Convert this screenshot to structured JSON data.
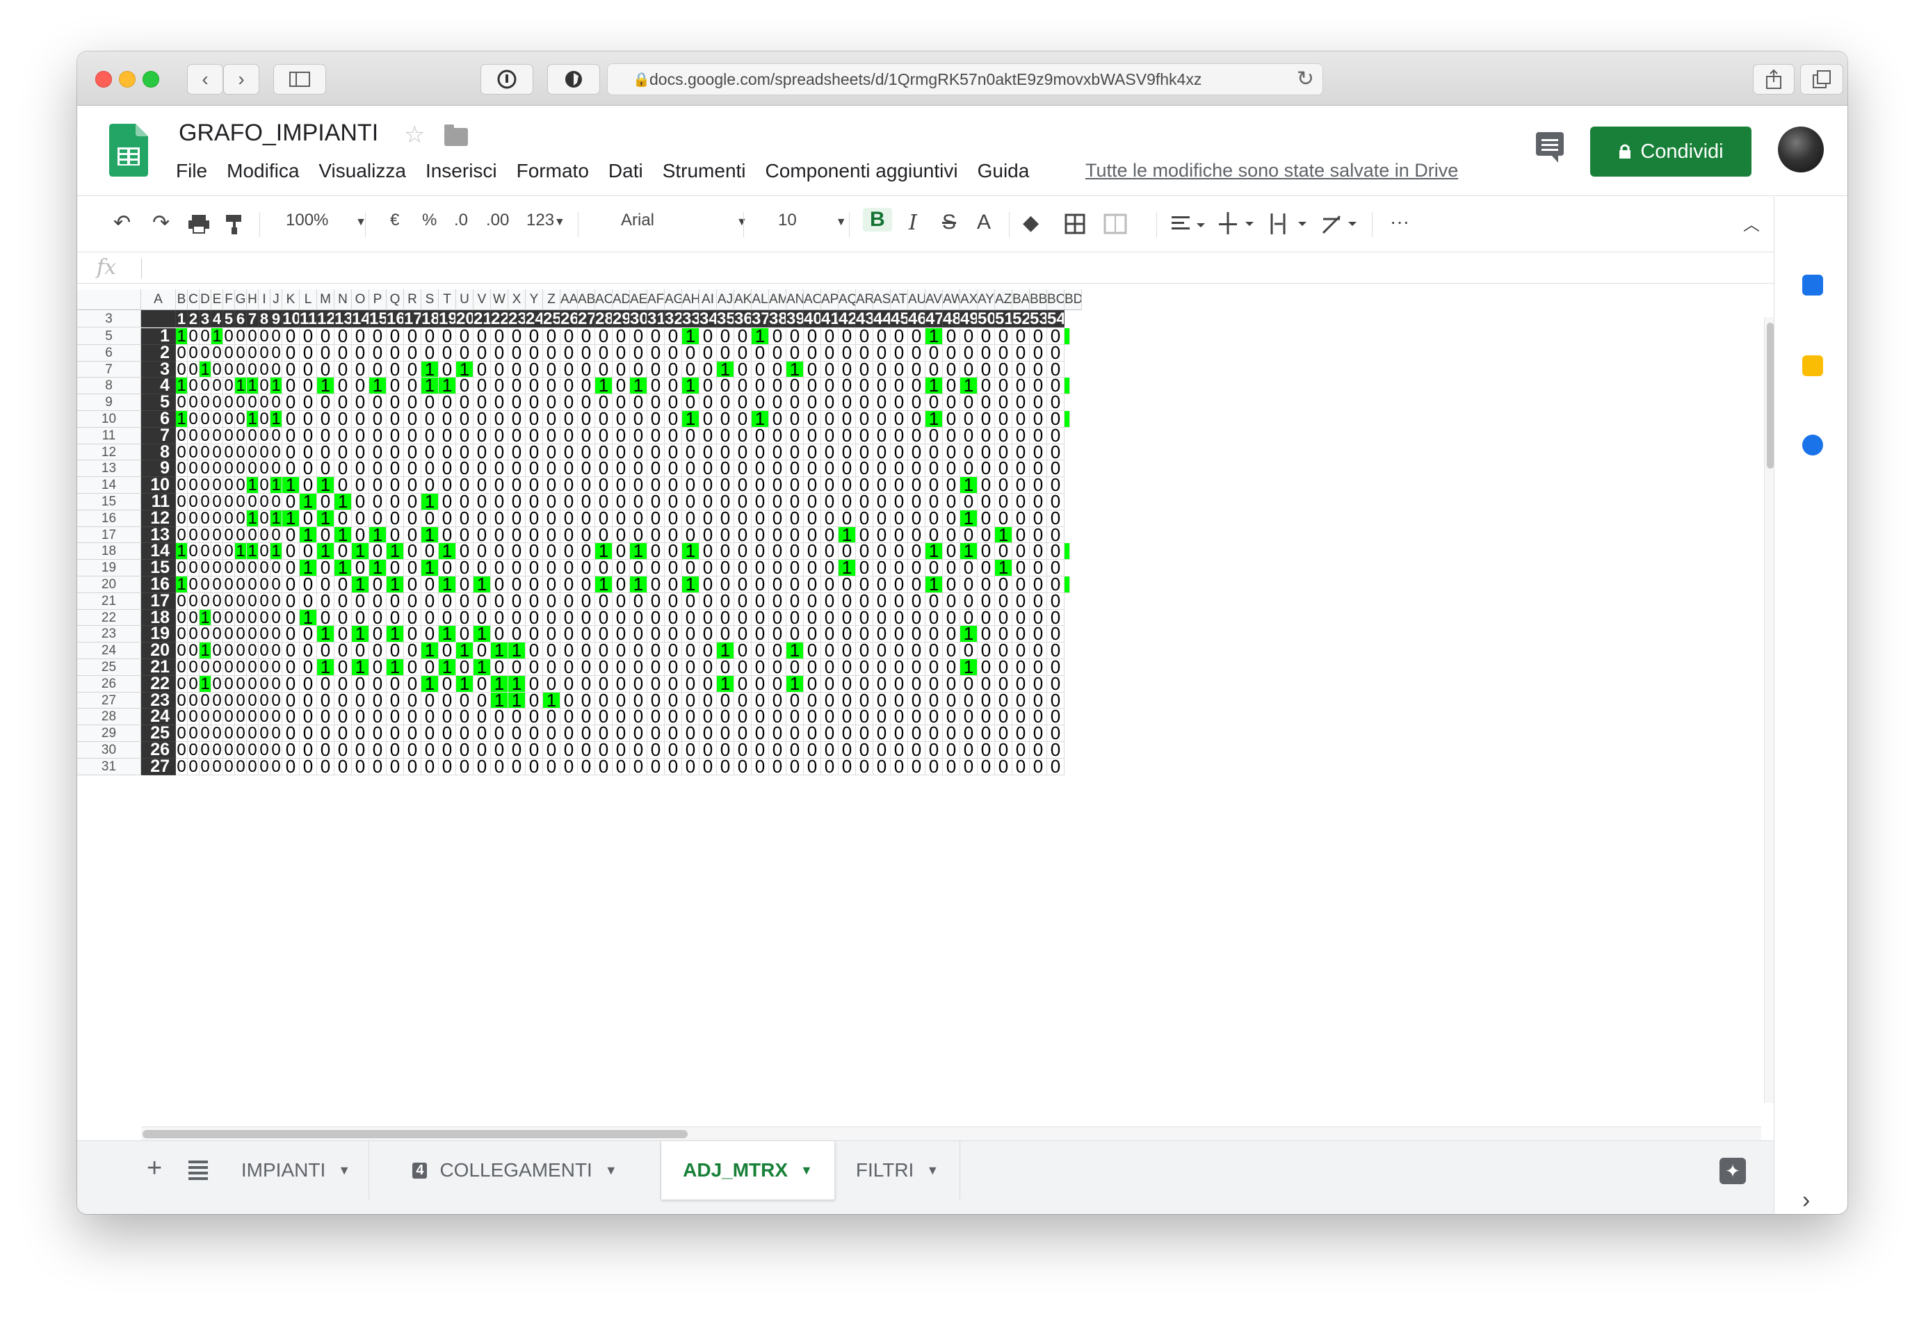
{
  "browser": {
    "url": "docs.google.com/spreadsheets/d/1QrmgRK57n0aktE9z9movxbWASV9fhk4xz"
  },
  "doc": {
    "title": "GRAFO_IMPIANTI",
    "menu": [
      "File",
      "Modifica",
      "Visualizza",
      "Inserisci",
      "Formato",
      "Dati",
      "Strumenti",
      "Componenti aggiuntivi",
      "Guida"
    ],
    "saved_status": "Tutte le modifiche sono state salvate in Drive",
    "share_label": "Condividi"
  },
  "toolbar": {
    "zoom": "100%",
    "currency": "€",
    "percent": "%",
    "dec_less": ".0",
    "dec_more": ".00",
    "number_format": "123",
    "font": "Arial",
    "font_size": "10",
    "more": "···"
  },
  "formula_bar": {
    "fx": "fx",
    "value": ""
  },
  "grid": {
    "column_letters": [
      "A",
      "B",
      "C",
      "D",
      "E",
      "F",
      "G",
      "H",
      "I",
      "J",
      "K",
      "L",
      "M",
      "N",
      "O",
      "P",
      "Q",
      "R",
      "S",
      "T",
      "U",
      "V",
      "W",
      "X",
      "Y",
      "Z",
      "AA",
      "AB",
      "AC",
      "AD",
      "AE",
      "AF",
      "AG",
      "AH",
      "AI",
      "AJ",
      "AK",
      "AL",
      "AM",
      "AN",
      "AO",
      "AP",
      "AQ",
      "AR",
      "AS",
      "AT",
      "AU",
      "AV",
      "AW",
      "AX",
      "AY",
      "AZ",
      "BA",
      "BB",
      "BC",
      "BD"
    ],
    "row_numbers": [
      3,
      5,
      6,
      7,
      8,
      9,
      10,
      11,
      12,
      13,
      14,
      15,
      16,
      17,
      18,
      19,
      20,
      21,
      22,
      23,
      24,
      25,
      26,
      27,
      28,
      29,
      30,
      31
    ],
    "ones": {
      "1": [
        1,
        4,
        33,
        37,
        47
      ],
      "3": [
        3,
        18,
        20,
        35,
        39
      ],
      "4": [
        1,
        6,
        7,
        9,
        12,
        15,
        18,
        19,
        28,
        30,
        33,
        47,
        49
      ],
      "6": [
        1,
        7,
        9,
        33,
        37,
        47
      ],
      "10": [
        7,
        9,
        10,
        12,
        49
      ],
      "11": [
        11,
        13,
        18
      ],
      "12": [
        7,
        9,
        10,
        12,
        49
      ],
      "13": [
        11,
        13,
        15,
        18,
        42,
        51
      ],
      "14": [
        1,
        6,
        7,
        9,
        12,
        14,
        16,
        19,
        28,
        30,
        33,
        47,
        49
      ],
      "15": [
        11,
        13,
        15,
        18,
        42,
        51
      ],
      "16": [
        1,
        14,
        16,
        19,
        21,
        28,
        30,
        33,
        47
      ],
      "18": [
        3,
        11
      ],
      "19": [
        12,
        14,
        16,
        19,
        21,
        49
      ],
      "20": [
        3,
        18,
        20,
        22,
        23,
        35,
        39
      ],
      "21": [
        12,
        14,
        16,
        19,
        21,
        49
      ],
      "22": [
        3,
        18,
        20,
        22,
        23,
        35,
        39
      ],
      "23": [
        22,
        23,
        25
      ]
    },
    "green_edge_rows": [
      1,
      4,
      6,
      14,
      16
    ]
  },
  "sheets": [
    {
      "label": "IMPIANTI",
      "active": false
    },
    {
      "label": "COLLEGAMENTI",
      "active": false,
      "badge": "4"
    },
    {
      "label": "ADJ_MTRX",
      "active": true
    },
    {
      "label": "FILTRI",
      "active": false
    }
  ],
  "colors": {
    "accent": "#188038",
    "cell_highlight": "#00ff00",
    "header_dark": "#333333"
  }
}
